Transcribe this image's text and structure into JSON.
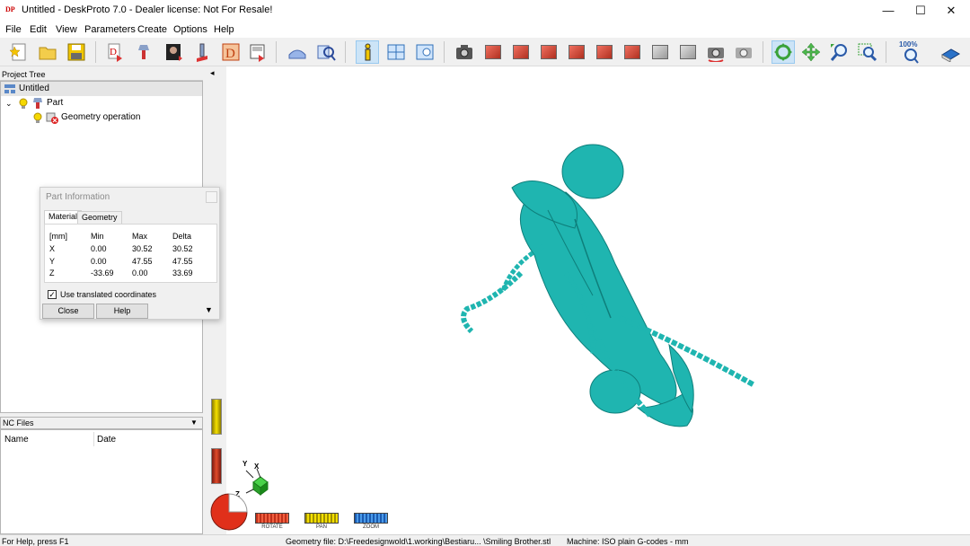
{
  "window": {
    "app_icon_text": "DP",
    "title": "Untitled - DeskProto 7.0 - Dealer license: Not For Resale!",
    "minimize_glyph": "—",
    "maximize_glyph": "☐",
    "close_glyph": "✕"
  },
  "menu": [
    "File",
    "Edit",
    "View",
    "Parameters",
    "Create",
    "Options",
    "Help"
  ],
  "toolbar": {
    "zoom_100_label": "100%"
  },
  "project_tree": {
    "header": "Project Tree",
    "root": "Untitled",
    "part": "Part",
    "operation": "Geometry operation"
  },
  "nc_files": {
    "header": "NC Files",
    "col_name": "Name",
    "col_date": "Date"
  },
  "part_info": {
    "title": "Part Information",
    "tab_material": "Material",
    "tab_geometry": "Geometry",
    "unit": "[mm]",
    "columns": [
      "Min",
      "Max",
      "Delta"
    ],
    "rows": [
      {
        "axis": "X",
        "min": "0.00",
        "max": "30.52",
        "delta": "30.52"
      },
      {
        "axis": "Y",
        "min": "0.00",
        "max": "47.55",
        "delta": "47.55"
      },
      {
        "axis": "Z",
        "min": "-33.69",
        "max": "0.00",
        "delta": "33.69"
      }
    ],
    "checkbox_label": "Use translated coordinates",
    "checkbox_mark": "✓",
    "close_label": "Close",
    "help_label": "Help"
  },
  "viewport": {
    "collapse_glyph": "◂",
    "axis_y": "Y",
    "axis_x": "X",
    "axis_z": "Z",
    "model_color": "#1fb5b0",
    "controls": {
      "rotate": "ROTATE",
      "pan": "PAN",
      "zoom": "ZOOM"
    }
  },
  "status": {
    "help": "For Help, press F1",
    "geometry_file": "Geometry file: D:\\Freedesignwold\\1.working\\Bestiaru... \\Smiling Brother.stl",
    "machine": "Machine: ISO plain G-codes - mm"
  }
}
